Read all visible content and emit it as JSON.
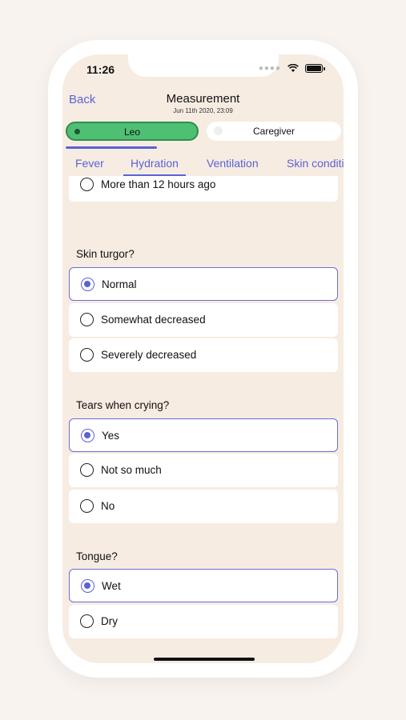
{
  "status_bar": {
    "time": "11:26"
  },
  "header": {
    "back_label": "Back",
    "title": "Measurement",
    "subtitle": "Jun 11th 2020, 23:09"
  },
  "segments": {
    "left": "Leo",
    "right": "Caregiver"
  },
  "progress": 0.33,
  "tabs": [
    "Fever",
    "Hydration",
    "Ventilation",
    "Skin conditi"
  ],
  "active_tab": "Hydration",
  "questions": [
    {
      "label": "",
      "options": [
        {
          "text": "More than 12 hours ago",
          "selected": false
        }
      ]
    },
    {
      "label": "Skin turgor?",
      "options": [
        {
          "text": "Normal",
          "selected": true
        },
        {
          "text": "Somewhat decreased",
          "selected": false
        },
        {
          "text": "Severely decreased",
          "selected": false
        }
      ]
    },
    {
      "label": "Tears when crying?",
      "options": [
        {
          "text": "Yes",
          "selected": true
        },
        {
          "text": "Not so much",
          "selected": false
        },
        {
          "text": "No",
          "selected": false
        }
      ]
    },
    {
      "label": "Tongue?",
      "options": [
        {
          "text": "Wet",
          "selected": true
        },
        {
          "text": "Dry",
          "selected": false
        }
      ]
    }
  ],
  "colors": {
    "accent": "#5b62d6",
    "green": "#4fbf73",
    "background": "#f7ece2"
  }
}
